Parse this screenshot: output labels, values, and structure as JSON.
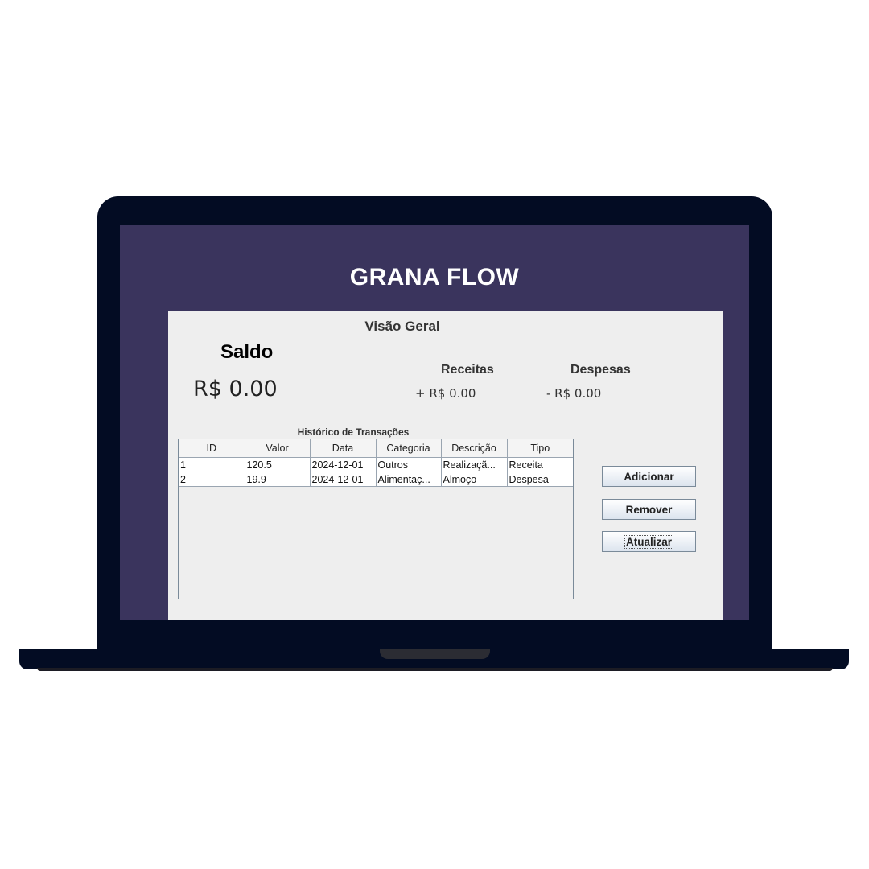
{
  "app": {
    "title": "GRANA FLOW"
  },
  "overview": {
    "title": "Visão Geral",
    "saldo_label": "Saldo",
    "saldo_value": "R$ 0.00",
    "receitas_label": "Receitas",
    "receitas_value": "+ R$ 0.00",
    "despesas_label": "Despesas",
    "despesas_value": "- R$ 0.00"
  },
  "transactions": {
    "caption": "Histórico de Transações",
    "columns": [
      "ID",
      "Valor",
      "Data",
      "Categoria",
      "Descrição",
      "Tipo"
    ],
    "rows": [
      [
        "1",
        "120.5",
        "2024-12-01",
        "Outros",
        "Realizaçã...",
        "Receita"
      ],
      [
        "2",
        "19.9",
        "2024-12-01",
        "Alimentaç...",
        "Almoço",
        "Despesa"
      ]
    ]
  },
  "buttons": {
    "add": "Adicionar",
    "remove": "Remover",
    "update": "Atualizar"
  },
  "colors": {
    "laptop_frame": "#030c23",
    "app_background": "#3a345d",
    "panel_background": "#eeeeee",
    "title_text": "#ffffff"
  }
}
